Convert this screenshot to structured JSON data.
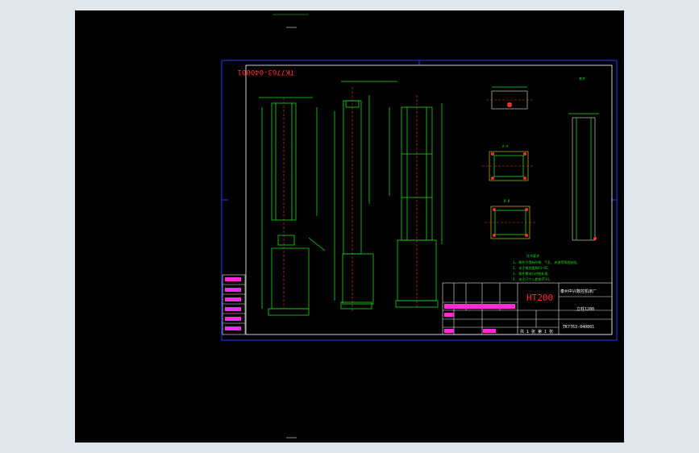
{
  "drawing": {
    "drawing_number_rotated": "TK7763-040001",
    "material": "HT200",
    "company": "泰州中兴数控机床厂",
    "part_name": "立柱1200",
    "drawing_number": "TK7763-040001",
    "sheet_info": "共 1 张 第 1 张",
    "technical_requirements_title": "技术要求",
    "technical_requirements": [
      "1. 铸件不得有砂眼、气孔、夹渣等铸造缺陷。",
      "2. 未注铸造圆角R3~R5。",
      "3. 铸件需进行时效处理。",
      "4. 未注尺寸公差按IT14。"
    ],
    "section_labels": [
      "A-A",
      "B-B",
      "C-C"
    ],
    "surface_mark": "其余"
  },
  "colors": {
    "background": "#000000",
    "sheet_border": "#1e3cff",
    "geometry": "#1fd81f",
    "centerline": "#ff3030",
    "title_text": "#ff2bd6",
    "material_text": "#ff2b2b"
  }
}
